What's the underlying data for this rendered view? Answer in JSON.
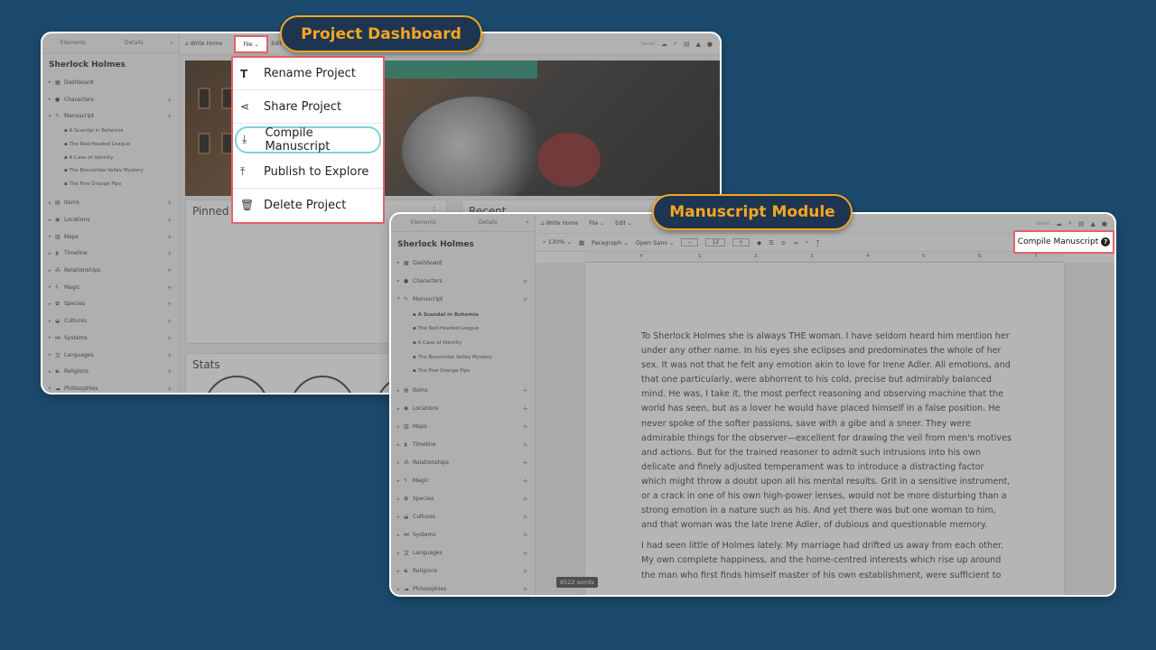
{
  "labels": {
    "project_dashboard": "Project Dashboard",
    "manuscript_module": "Manuscript Module"
  },
  "colors": {
    "background": "#1c4a6e",
    "label_bg": "#1d3550",
    "label_text": "#f5a623",
    "highlight_box": "#e3626c",
    "highlight_pill": "#7fd3d9"
  },
  "sidebar": {
    "tabs": [
      "Elements",
      "Details"
    ],
    "project_title": "Sherlock Holmes",
    "dashboard": "Dashboard",
    "characters": "Characters",
    "manuscript": "Manuscript",
    "chapters": [
      "A Scandal in Bohemia",
      "The Red-Headed League",
      "A Case of Identity",
      "The Boscombe Valley Mystery",
      "The Five Orange Pips"
    ],
    "items": [
      "Items",
      "Locations",
      "Maps",
      "Timeline",
      "Relationships",
      "Magic",
      "Species",
      "Cultures",
      "Systems",
      "Languages",
      "Religions",
      "Philosophies"
    ]
  },
  "topbar": {
    "write_home": "Write Home",
    "file": "File",
    "edit": "Edit",
    "saved": "Saved"
  },
  "dashboard": {
    "file_menu": {
      "items": [
        {
          "label": "Rename Project",
          "icon": "text-icon"
        },
        {
          "label": "Share Project",
          "icon": "share-icon"
        },
        {
          "label": "Compile Manuscript",
          "icon": "download-icon"
        },
        {
          "label": "Publish to Explore",
          "icon": "upload-icon"
        },
        {
          "label": "Delete Project",
          "icon": "trash-icon"
        }
      ]
    },
    "cards": {
      "pinned": "Pinned",
      "recent": "Recent",
      "stats": "Stats"
    }
  },
  "manuscript": {
    "toolbar": {
      "zoom": "130%",
      "style": "Paragraph",
      "font": "Open Sans",
      "size": "12"
    },
    "compile_button": "Compile Manuscript",
    "ruler": [
      "1",
      "2",
      "3",
      "4",
      "5",
      "6",
      "7"
    ],
    "paragraphs": [
      "To Sherlock Holmes she is always THE woman. I have seldom heard him mention her under any other name. In his eyes she eclipses and predominates the whole of her sex. It was not that he felt any emotion akin to love for Irene Adler. All emotions, and that one particularly, were abhorrent to his cold, precise but admirably balanced mind. He was, I take it, the most perfect reasoning and observing machine that the world has seen, but as a lover he would have placed himself in a false position. He never spoke of the softer passions, save with a gibe and a sneer. They were admirable things for the observer—excellent for drawing the veil from men's motives and actions. But for the trained reasoner to admit such intrusions into his own delicate and finely adjusted temperament was to introduce a distracting factor which might throw a doubt upon all his mental results. Grit in a sensitive instrument, or a crack in one of his own high-power lenses, would not be more disturbing than a strong emotion in a nature such as his. And yet there was but one woman to him, and that woman was the late Irene Adler, of dubious and questionable memory.",
      "I had seen little of Holmes lately. My marriage had drifted us away from each other. My own complete happiness, and the home-centred interests which rise up around the man who first finds himself master of his own establishment, were sufficient to"
    ],
    "word_count": "8522 words"
  }
}
